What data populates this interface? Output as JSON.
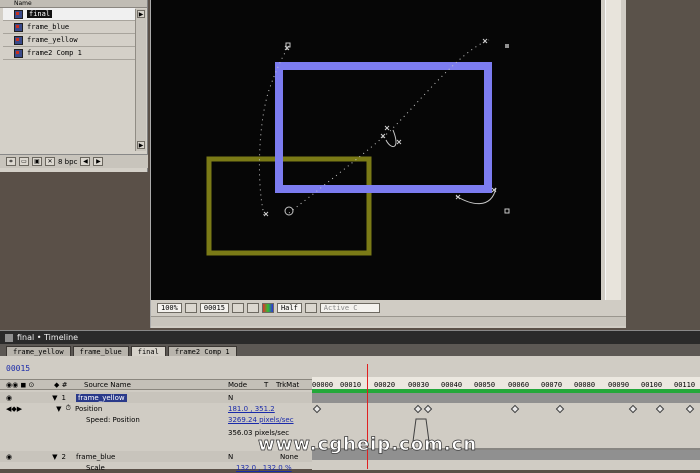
{
  "project": {
    "header": "Name",
    "items": [
      {
        "label": "final",
        "selected": true
      },
      {
        "label": "frame_blue",
        "selected": false
      },
      {
        "label": "frame_yellow",
        "selected": false
      },
      {
        "label": "frame2 Comp 1",
        "selected": false
      }
    ],
    "bpc": "8 bpc"
  },
  "comp_toolbar": {
    "zoom": "100%",
    "timecode": "00015",
    "resolution": "Half",
    "camera": "Active C"
  },
  "timeline": {
    "title": "final • Timeline",
    "tabs": [
      "frame_yellow",
      "frame_blue",
      "final",
      "frame2 Comp 1"
    ],
    "active_tab": "final",
    "current_time": "00015",
    "col_source": "Source Name",
    "col_mode": "Mode",
    "col_t": "T",
    "col_trkmat": "TrkMat",
    "ruler_labels": [
      "00000",
      "00010",
      "00020",
      "00030",
      "00040",
      "00050",
      "00060",
      "00070",
      "00080",
      "00090",
      "00100",
      "00110"
    ],
    "layers": [
      {
        "num": "1",
        "name": "frame_yellow",
        "mode": "N"
      },
      {
        "num": "2",
        "name": "frame_blue",
        "mode": "N",
        "trkmat": "None"
      }
    ],
    "position_label": "Position",
    "position_value": "181.0 , 351.2",
    "speed_label": "Speed: Position",
    "speed_value": "3269.24 pixels/sec",
    "speed_value2": "356.03 pixels/sec",
    "scale_label": "Scale",
    "scale_value": "132.0 , 132.0 %"
  },
  "watermark": "www.cgheip.com.cn",
  "colors": {
    "blue_frame": "#7c7cf0",
    "yellow_frame": "#7a7a16",
    "work_area": "#24a83a",
    "playhead": "#e02020"
  }
}
